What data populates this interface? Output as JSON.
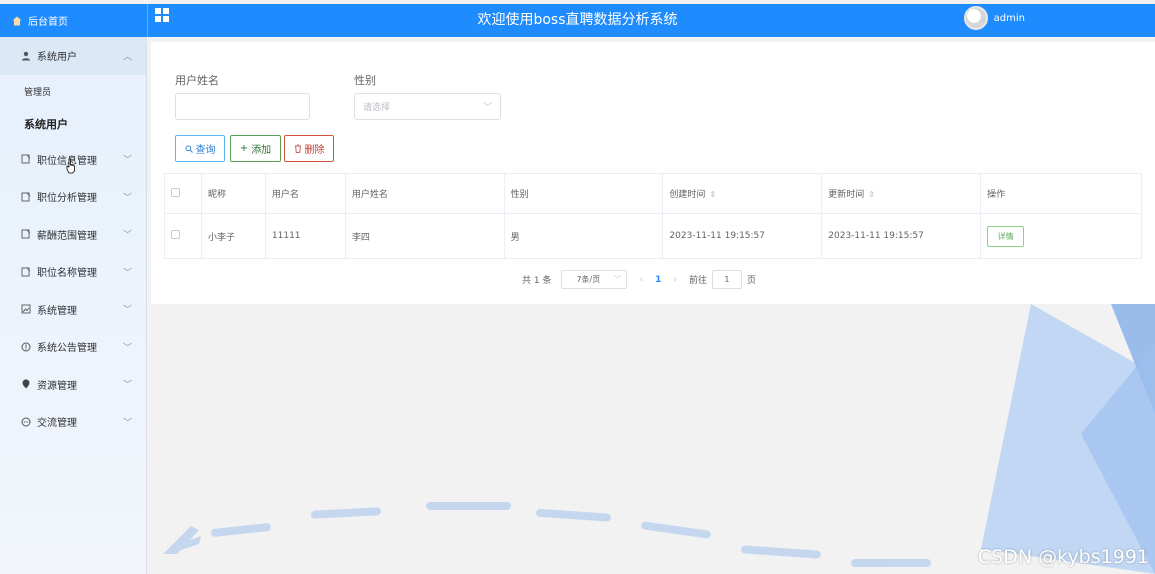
{
  "header": {
    "home_label": "后台首页",
    "title": "欢迎使用boss直聘数据分析系统",
    "username": "admin"
  },
  "sidebar": {
    "groups": [
      {
        "label": "系统用户",
        "icon": "user-icon",
        "open": true,
        "children": [
          {
            "label": "管理员",
            "active": false
          },
          {
            "label": "系统用户",
            "active": true
          }
        ]
      },
      {
        "label": "职位信息管理",
        "icon": "document-icon"
      },
      {
        "label": "职位分析管理",
        "icon": "document-icon"
      },
      {
        "label": "薪酬范围管理",
        "icon": "document-icon"
      },
      {
        "label": "职位名称管理",
        "icon": "document-icon"
      },
      {
        "label": "系统管理",
        "icon": "picture-icon"
      },
      {
        "label": "系统公告管理",
        "icon": "info-icon"
      },
      {
        "label": "资源管理",
        "icon": "pin-icon"
      },
      {
        "label": "交流管理",
        "icon": "chat-icon"
      }
    ]
  },
  "search": {
    "name_label": "用户姓名",
    "name_value": "",
    "gender_label": "性别",
    "gender_placeholder": "请选择"
  },
  "buttons": {
    "search": "查询",
    "add": "添加",
    "delete": "删除"
  },
  "table": {
    "headers": [
      "昵称",
      "用户名",
      "用户姓名",
      "性别",
      "创建时间",
      "更新时间",
      "操作"
    ],
    "rows": [
      {
        "nickname": "小李子",
        "username": "11111",
        "realname": "李四",
        "gender": "男",
        "created": "2023-11-11 19:15:57",
        "updated": "2023-11-11 19:15:57",
        "action": "详情"
      }
    ]
  },
  "pagination": {
    "total": "共 1 条",
    "page_size": "7条/页",
    "current_page": "1",
    "goto_label": "前往",
    "goto_value": "1",
    "page_suffix": "页"
  },
  "watermark": "CSDN @kybs1991",
  "colors": {
    "primary": "#1e8cff",
    "search_btn": "#59b6f5",
    "add_btn": "#58a05a",
    "delete_btn": "#d2543a",
    "detail_btn": "#8cd18b",
    "deco_blue": "#a8c8f2"
  }
}
